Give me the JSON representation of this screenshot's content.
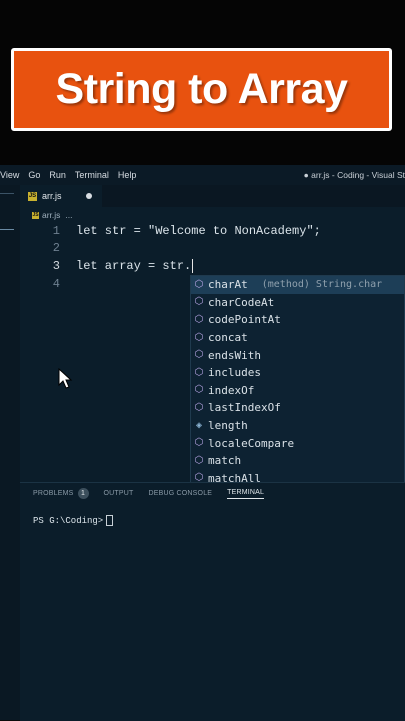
{
  "banner": {
    "title": "String to Array"
  },
  "menubar": {
    "items": [
      "View",
      "Go",
      "Run",
      "Terminal",
      "Help"
    ],
    "window_title": "● arr.js - Coding - Visual St"
  },
  "tab": {
    "name": "arr.js",
    "icon": "js-file-icon"
  },
  "breadcrumb": {
    "file": "arr.js",
    "more": "..."
  },
  "editor": {
    "lines": [
      {
        "number": "1",
        "tokens": [
          "let",
          " str = ",
          "\"Welcome to NonAcademy\"",
          ";"
        ]
      },
      {
        "number": "2",
        "tokens": []
      },
      {
        "number": "3",
        "tokens": [
          "let",
          " array = str."
        ]
      },
      {
        "number": "4",
        "tokens": []
      }
    ]
  },
  "suggestions": {
    "items": [
      {
        "label": "charAt",
        "detail": "(method) String.char",
        "icon": "method-cube-icon"
      },
      {
        "label": "charCodeAt",
        "icon": "method-cube-icon"
      },
      {
        "label": "codePointAt",
        "icon": "method-cube-icon"
      },
      {
        "label": "concat",
        "icon": "method-cube-icon"
      },
      {
        "label": "endsWith",
        "icon": "method-cube-icon"
      },
      {
        "label": "includes",
        "icon": "method-cube-icon"
      },
      {
        "label": "indexOf",
        "icon": "method-cube-icon"
      },
      {
        "label": "lastIndexOf",
        "icon": "method-cube-icon"
      },
      {
        "label": "length",
        "icon": "property-icon"
      },
      {
        "label": "localeCompare",
        "icon": "method-cube-icon"
      },
      {
        "label": "match",
        "icon": "method-cube-icon"
      },
      {
        "label": "matchAll",
        "icon": "method-cube-icon"
      }
    ]
  },
  "panel": {
    "tabs": [
      "PROBLEMS",
      "OUTPUT",
      "DEBUG CONSOLE",
      "TERMINAL"
    ],
    "problems_count": "1",
    "prompt": "PS G:\\Coding>"
  },
  "colors": {
    "banner": "#e8520f",
    "editor_bg": "#0b1d2a",
    "selection": "#1d3e57"
  }
}
